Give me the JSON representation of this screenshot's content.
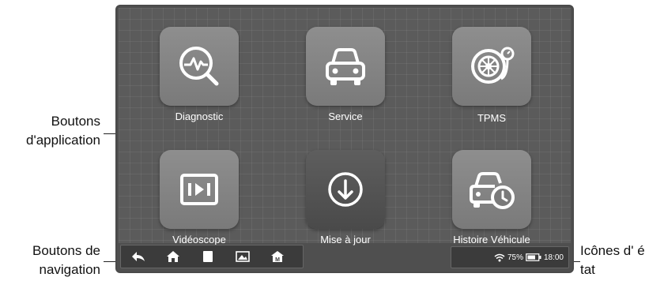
{
  "callouts": {
    "apps_line1": "Boutons",
    "apps_line2": "d'application",
    "nav_line1": "Boutons de",
    "nav_line2": "navigation",
    "status_line1": "Icônes  d' é",
    "status_line2": "tat"
  },
  "apps": [
    {
      "label": "Diagnostic",
      "icon": "diagnostic-magnifier-icon"
    },
    {
      "label": "Service",
      "icon": "car-icon"
    },
    {
      "label": "TPMS",
      "icon": "tire-gauge-icon"
    },
    {
      "label": "Vidéoscope",
      "icon": "videoscope-play-icon"
    },
    {
      "label": "Mise à jour",
      "icon": "download-arrow-icon"
    },
    {
      "label": "Histoire Véhicule",
      "icon": "car-history-icon"
    }
  ],
  "navigation": {
    "buttons": [
      "back-icon",
      "home-icon",
      "recent-apps-icon",
      "screenshot-icon",
      "manufacturer-home-icon"
    ]
  },
  "status": {
    "battery": "75%",
    "time": "18:00"
  },
  "colors": {
    "screen": "#5b5b5b",
    "app_tile": "#8a8a8a",
    "app_tile_dark": "#555555",
    "bar": "#3b3b3b"
  }
}
